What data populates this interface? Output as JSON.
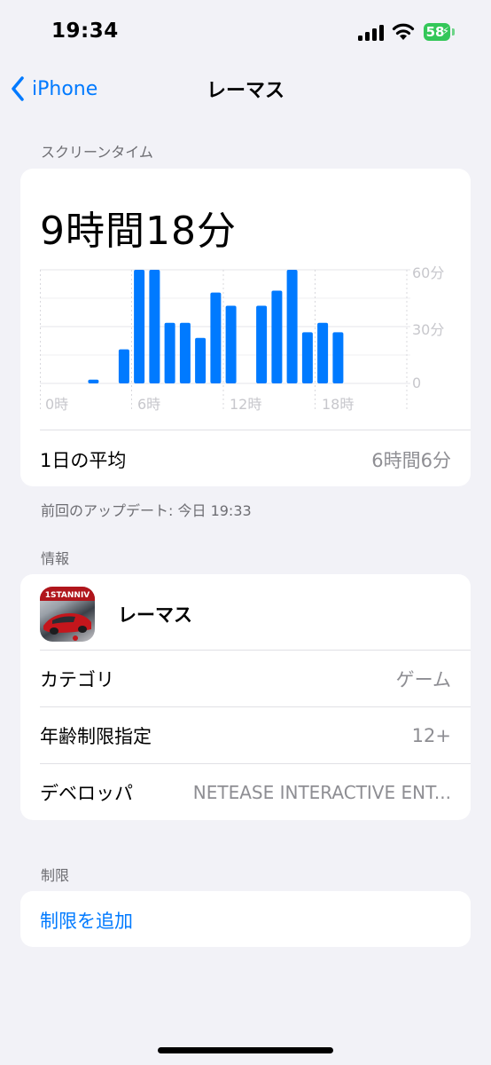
{
  "status_bar": {
    "time": "19:34",
    "battery_percent": "58",
    "battery_color": "#34c759"
  },
  "nav": {
    "back_label": "iPhone",
    "title": "レーマス"
  },
  "screen_time": {
    "section_header": "スクリーンタイム",
    "total": "9時間18分",
    "average_label": "1日の平均",
    "average_value": "6時間6分",
    "last_update": "前回のアップデート: 今日 19:33"
  },
  "chart_data": {
    "type": "bar",
    "x": [
      0,
      1,
      2,
      3,
      4,
      5,
      6,
      7,
      8,
      9,
      10,
      11,
      12,
      13,
      14,
      15,
      16,
      17,
      18,
      19,
      20,
      21,
      22,
      23
    ],
    "values": [
      0,
      0,
      0,
      2,
      0,
      18,
      60,
      60,
      32,
      32,
      24,
      48,
      41,
      0,
      41,
      49,
      60,
      27,
      32,
      27,
      0,
      0,
      0,
      0
    ],
    "xticks": [
      "0時",
      "6時",
      "12時",
      "18時"
    ],
    "yticks": [
      "60分",
      "30分",
      "0"
    ],
    "ylim": [
      0,
      60
    ],
    "color": "#007aff",
    "grid": true
  },
  "info": {
    "section_header": "情報",
    "app_name": "レーマス",
    "app_icon_badge": "1STANNIV",
    "rows": [
      {
        "label": "カテゴリ",
        "value": "ゲーム"
      },
      {
        "label": "年齢制限指定",
        "value": "12+"
      },
      {
        "label": "デベロッパ",
        "value": "NETEASE INTERACTIVE ENT..."
      }
    ]
  },
  "restrictions": {
    "section_header": "制限",
    "add_label": "制限を追加"
  },
  "colors": {
    "accent": "#007aff",
    "background": "#f2f2f7",
    "secondary_text": "#8e8e93"
  }
}
